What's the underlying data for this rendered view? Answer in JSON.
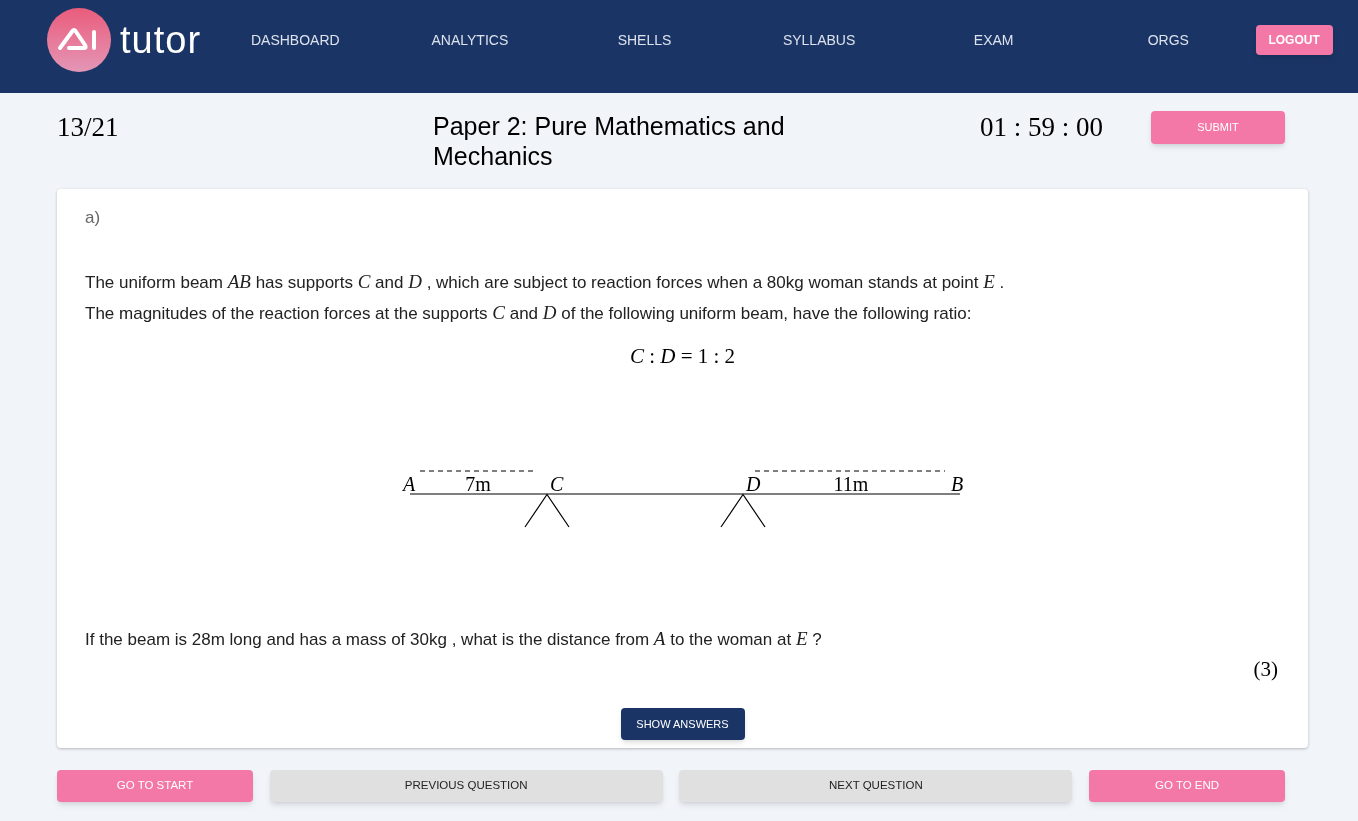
{
  "nav": {
    "brand": "tutor",
    "links": [
      "DASHBOARD",
      "ANALYTICS",
      "SHELLS",
      "SYLLABUS",
      "EXAM",
      "ORGS"
    ],
    "logout": "LOGOUT"
  },
  "header": {
    "counter": "13/21",
    "title": "Paper 2: Pure Mathematics and Mechanics",
    "timer": "01 : 59 : 00",
    "submit": "SUBMIT"
  },
  "question": {
    "part": "a)",
    "text": [
      "The uniform beam *AB* has supports *C* and *D* , which are subject to reaction forces when a 80kg woman stands at point *E* .",
      "The magnitudes of the reaction forces at the supports *C* and *D* of the following uniform beam, have the following ratio:"
    ],
    "equation": "*C* : *D* = 1 : 2",
    "diagram": {
      "points": [
        "A",
        "C",
        "D",
        "B"
      ],
      "lengths": [
        "7m",
        "11m"
      ]
    },
    "prompt": "If the beam is 28m long and has a mass of 30kg , what is the distance from *A* to the woman at *E* ?",
    "marks": "(3)",
    "show_answers": "SHOW ANSWERS"
  },
  "footer_buttons": [
    {
      "label": "GO TO START",
      "kind": "accent"
    },
    {
      "label": "PREVIOUS QUESTION",
      "kind": "plain"
    },
    {
      "label": "NEXT QUESTION",
      "kind": "plain"
    },
    {
      "label": "GO TO END",
      "kind": "accent"
    }
  ]
}
